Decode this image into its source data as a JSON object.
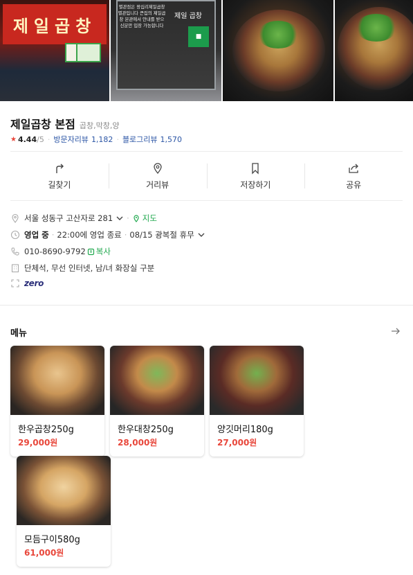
{
  "photos": {
    "p1_sign": "제일곱창",
    "p2_note": "별관점은 왕십리제일곱창 별관입니다 큰집의 제일곱창 본관에서 안내를 받으신분만 입장 가능합니다",
    "p2_logo": "제일 곱창"
  },
  "place": {
    "name": "제일곱창 본점",
    "categories": "곱창,막창,양",
    "rating": "4.44",
    "rating_out_of": "/5",
    "visitor_reviews_label": "방문자리뷰",
    "visitor_reviews_count": "1,182",
    "blog_reviews_label": "블로그리뷰",
    "blog_reviews_count": "1,570"
  },
  "actions": [
    {
      "label": "길찾기",
      "icon": "directions-icon"
    },
    {
      "label": "거리뷰",
      "icon": "location-pin-icon"
    },
    {
      "label": "저장하기",
      "icon": "bookmark-icon"
    },
    {
      "label": "공유",
      "icon": "share-icon"
    }
  ],
  "info": {
    "address": "서울 성동구 고산자로 281",
    "map_label": "지도",
    "status": "영업 중",
    "hours": "22:00에 영업 종료",
    "holiday": "08/15 광복절 휴무",
    "phone": "010-8690-9792",
    "copy_label": "복사",
    "facilities": "단체석, 무선 인터넷, 남/녀 화장실 구분",
    "zero_label": "zero"
  },
  "menu": {
    "title": "메뉴",
    "items": [
      {
        "name": "한우곱창250g",
        "price": "29,000원"
      },
      {
        "name": "한우대창250g",
        "price": "28,000원"
      },
      {
        "name": "양깃머리180g",
        "price": "27,000원"
      },
      {
        "name": "모듬구이580g",
        "price": "61,000원"
      }
    ]
  },
  "colors": {
    "accent_red": "#e8473b",
    "link_blue": "#2b55a5",
    "green": "#1fa84d"
  }
}
